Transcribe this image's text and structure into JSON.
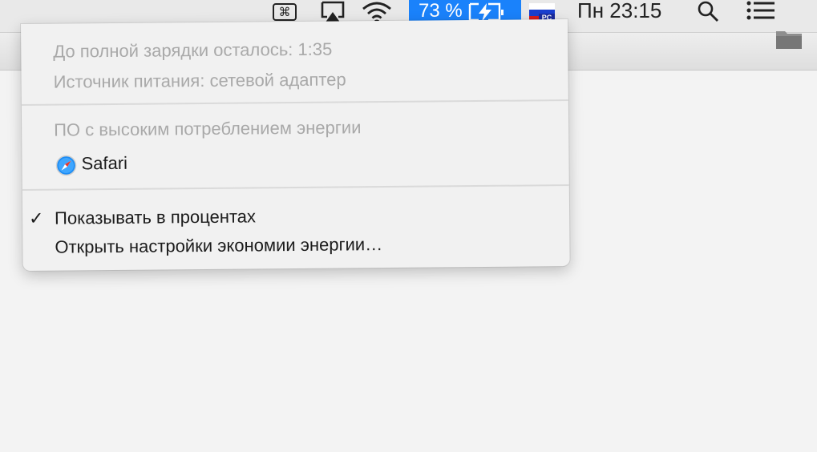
{
  "menubar": {
    "cmd_glyph": "⌘",
    "battery_percent": "73 %",
    "flag_label": "PC",
    "clock": "Пн 23:15",
    "icons": [
      "command-key-icon",
      "airplay-icon",
      "wifi-icon",
      "battery-charging-icon",
      "input-source-flag-icon",
      "spotlight-search-icon",
      "notification-center-icon"
    ],
    "accent_color": "#1a82fb"
  },
  "battery_menu": {
    "time_to_full": "До полной зарядки осталось: 1:35",
    "power_source": "Источник питания: сетевой адаптер",
    "energy_header": "ПО с высоким потреблением энергии",
    "energy_apps": [
      {
        "name": "Safari",
        "icon": "safari-icon"
      }
    ],
    "show_percentage": {
      "label": "Показывать в процентах",
      "checked": true,
      "check_glyph": "✓"
    },
    "open_energy_prefs": "Открыть настройки экономии энергии…"
  }
}
